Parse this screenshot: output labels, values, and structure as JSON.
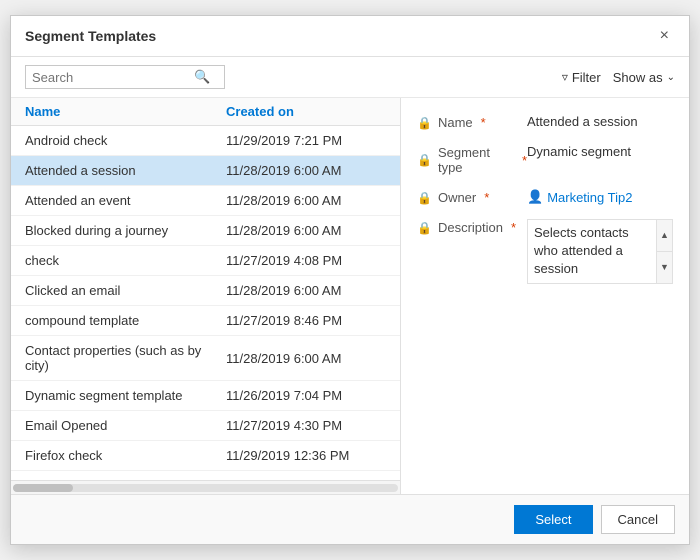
{
  "dialog": {
    "title": "Segment Templates",
    "close_label": "×"
  },
  "toolbar": {
    "search_placeholder": "Search",
    "search_icon": "🔍",
    "filter_label": "Filter",
    "filter_icon": "▽",
    "show_as_label": "Show as",
    "show_as_icon": "∨"
  },
  "list": {
    "header_name": "Name",
    "header_created": "Created on",
    "items": [
      {
        "name": "Android check",
        "date": "11/29/2019 7:21 PM",
        "selected": false
      },
      {
        "name": "Attended a session",
        "date": "11/28/2019 6:00 AM",
        "selected": true
      },
      {
        "name": "Attended an event",
        "date": "11/28/2019 6:00 AM",
        "selected": false
      },
      {
        "name": "Blocked during a journey",
        "date": "11/28/2019 6:00 AM",
        "selected": false
      },
      {
        "name": "check",
        "date": "11/27/2019 4:08 PM",
        "selected": false
      },
      {
        "name": "Clicked an email",
        "date": "11/28/2019 6:00 AM",
        "selected": false
      },
      {
        "name": "compound template",
        "date": "11/27/2019 8:46 PM",
        "selected": false
      },
      {
        "name": "Contact properties (such as by city)",
        "date": "11/28/2019 6:00 AM",
        "selected": false
      },
      {
        "name": "Dynamic segment template",
        "date": "11/26/2019 7:04 PM",
        "selected": false
      },
      {
        "name": "Email Opened",
        "date": "11/27/2019 4:30 PM",
        "selected": false
      },
      {
        "name": "Firefox check",
        "date": "11/29/2019 12:36 PM",
        "selected": false
      }
    ]
  },
  "detail": {
    "name_label": "Name",
    "name_value": "Attended a session",
    "segment_type_label": "Segment type",
    "segment_type_value": "Dynamic segment",
    "owner_label": "Owner",
    "owner_value": "Marketing Tip2",
    "description_label": "Description",
    "description_value": "Selects contacts who attended a session"
  },
  "footer": {
    "select_label": "Select",
    "cancel_label": "Cancel"
  }
}
